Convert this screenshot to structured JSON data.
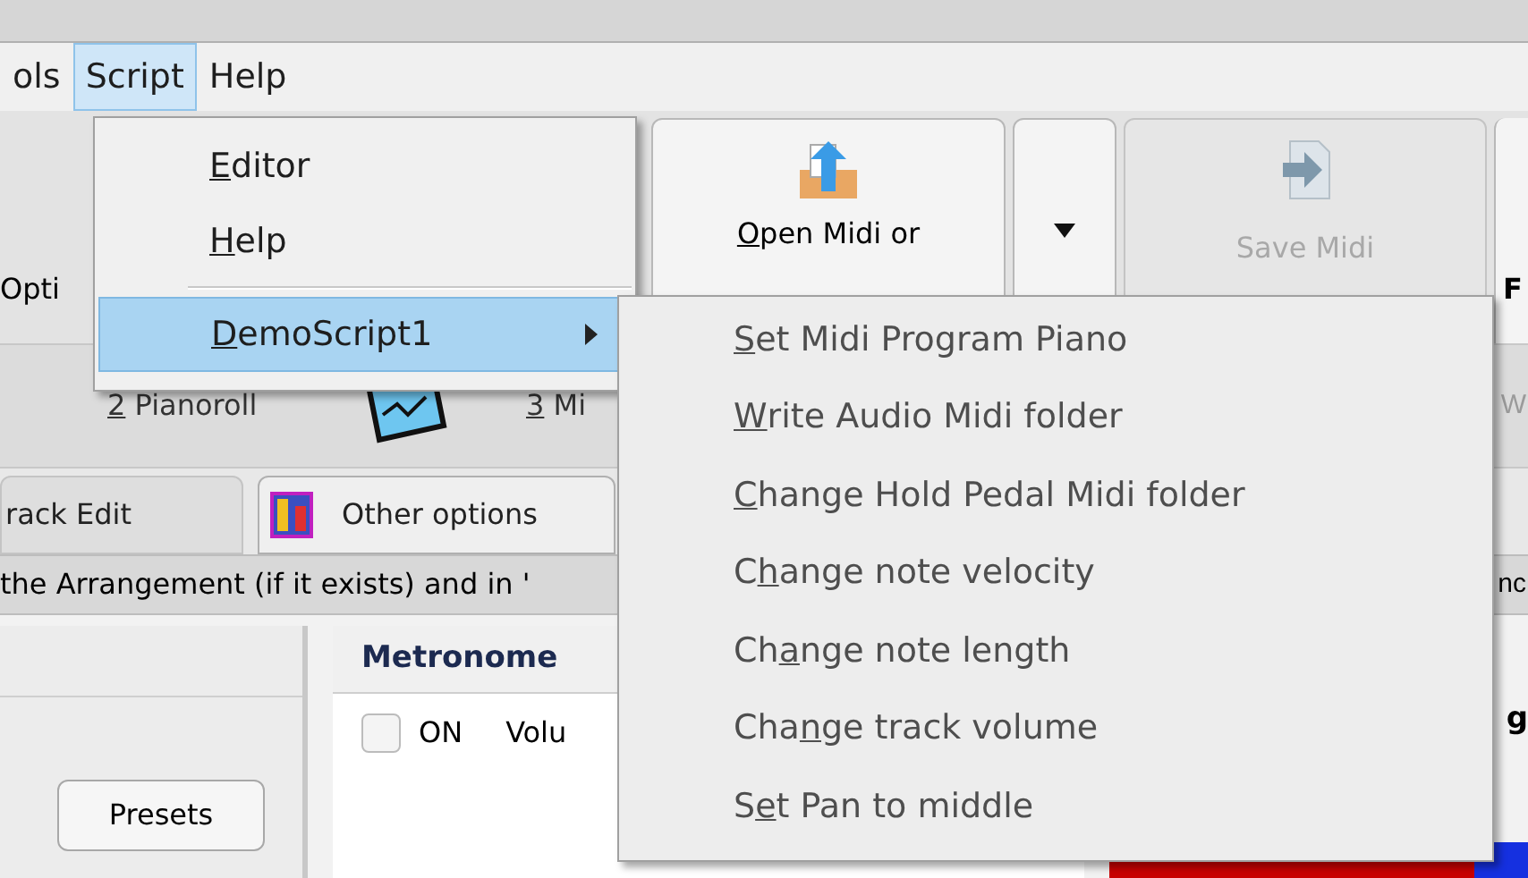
{
  "menu_bar": [
    {
      "label": "ols",
      "selected": false
    },
    {
      "label": "Script",
      "selected": true
    },
    {
      "label": "Help",
      "selected": false
    }
  ],
  "toolbar": {
    "options_label": "Opti",
    "open_button": {
      "key": "O",
      "rest": "pen Midi or"
    },
    "save_button": {
      "label": "Save Midi",
      "disabled": true
    },
    "edge_label": "F"
  },
  "view_tabs": [
    {
      "key": "2",
      "rest": " Pianoroll"
    },
    {
      "key": "3",
      "rest": " Mi"
    }
  ],
  "view_tabs_edge": "W",
  "option_tabs": [
    {
      "label": "rack Edit",
      "selected": false
    },
    {
      "label": "Other options",
      "selected": true
    }
  ],
  "info_line": {
    "text": "the Arrangement (if it exists) and in '",
    "edge": "nc"
  },
  "presets_button": "Presets",
  "metronome": {
    "title": "Metronome",
    "checkbox": {
      "label": "ON",
      "checked": false
    },
    "volume_label": "Volu"
  },
  "right_edge_label": "g",
  "script_menu": [
    {
      "kind": "item",
      "key": "E",
      "rest": "ditor"
    },
    {
      "kind": "item",
      "key": "H",
      "rest": "elp"
    },
    {
      "kind": "separator"
    },
    {
      "kind": "submenu",
      "key": "D",
      "rest": "emoScript1",
      "selected": true
    }
  ],
  "submenu": [
    {
      "key": "S",
      "rest": "et Midi Program Piano"
    },
    {
      "key": "W",
      "rest": "rite Audio Midi folder"
    },
    {
      "key": "C",
      "rest": "hange Hold Pedal Midi folder"
    },
    {
      "lead": "C",
      "key": "h",
      "rest": "ange note velocity"
    },
    {
      "lead": "Ch",
      "key": "a",
      "rest": "nge note length"
    },
    {
      "lead": "Cha",
      "key": "n",
      "rest": "ge track volume"
    },
    {
      "lead": "S",
      "key": "e",
      "rest": "t Pan to middle"
    }
  ]
}
